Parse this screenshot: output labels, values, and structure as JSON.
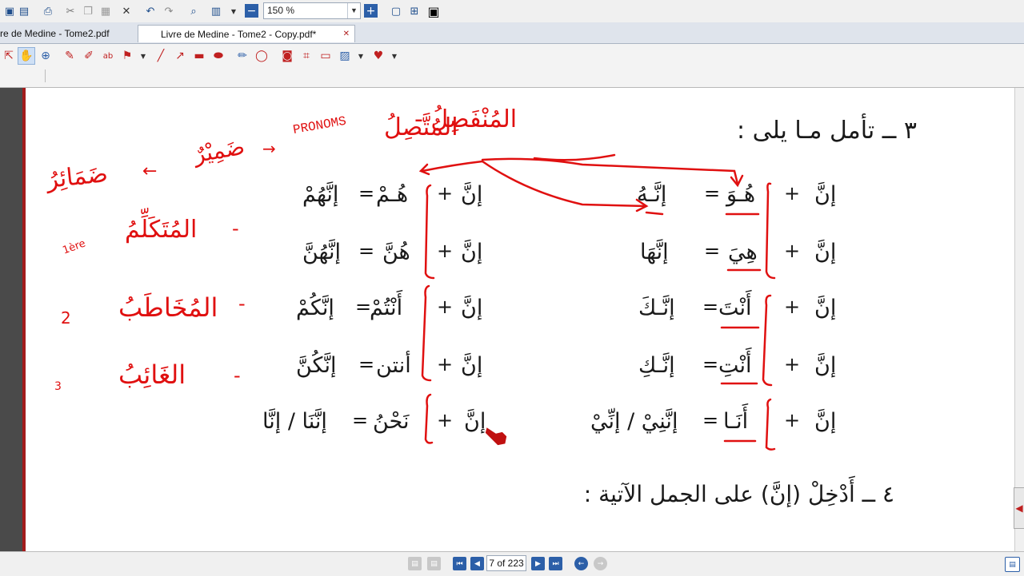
{
  "toolbar": {
    "zoom_value": "150 %"
  },
  "tabs": [
    {
      "label": "re de Medine - Tome2.pdf"
    },
    {
      "label": "Livre de Medine - Tome2 - Copy.pdf*",
      "close": "✕"
    }
  ],
  "document": {
    "heading3": "٣ ــ تأمل مـا يلى :",
    "rows": [
      {
        "rc1": "إنَّ",
        "rp": "+",
        "rc2": "هُـوَ",
        "req": "=",
        "rc3": "إنَّـهُ",
        "lc1": "إنَّ",
        "lp": "+",
        "lc2": "هُـمْ",
        "leq": "=",
        "lc3": "إنَّهُمْ"
      },
      {
        "rc1": "إنَّ",
        "rp": "+",
        "rc2": "هِيَ",
        "req": "=",
        "rc3": "إنَّهَا",
        "lc1": "إنَّ",
        "lp": "+",
        "lc2": "هُنَّ",
        "leq": "=",
        "lc3": "إنَّهُنَّ"
      },
      {
        "rc1": "إنَّ",
        "rp": "+",
        "rc2": "أَنْتَ",
        "req": "=",
        "rc3": "إنَّـكَ",
        "lc1": "إنَّ",
        "lp": "+",
        "lc2": "أَنْتُمْ",
        "leq": "=",
        "lc3": "إنَّكُمْ"
      },
      {
        "rc1": "إنَّ",
        "rp": "+",
        "rc2": "أَنْتِ",
        "req": "=",
        "rc3": "إنَّـكِ",
        "lc1": "إنَّ",
        "lp": "+",
        "lc2": "أنتن",
        "leq": "=",
        "lc3": "إنَّكُنَّ"
      },
      {
        "rc1": "إنَّ",
        "rp": "+",
        "rc2": "أَنَـا",
        "req": "=",
        "rc3": "إنَّنِيْ / إنِّيْ",
        "lc1": "إنَّ",
        "lp": "+",
        "lc2": "نَحْنُ",
        "leq": "=",
        "lc3": "إنَّنَا / إنَّا"
      }
    ],
    "heading4": "٤ ــ أَدْخِلْ (إنَّ) على الجمل الآتية :"
  },
  "annotations": {
    "top_munfasil": "المُنْفَصِلُ -",
    "top_muttasil": "المُتَّصِلُ",
    "pronoms": "PRONOMS",
    "damir": "ضَمِيْرٌ",
    "damair": "ضَمَائِرُ",
    "mutakallim": "المُتَكَلِّمُ",
    "mutakallim_note": "1ère",
    "mukhatab": "المُخَاطَبُ",
    "mukhatab_note": "2",
    "ghaib": "الغَائِبُ",
    "ghaib_note": "3"
  },
  "statusbar": {
    "page_display": "7 of 223"
  },
  "colors": {
    "ink": "#e01010",
    "accent": "#2c5fa8",
    "active_tab_close": "#b02020"
  }
}
